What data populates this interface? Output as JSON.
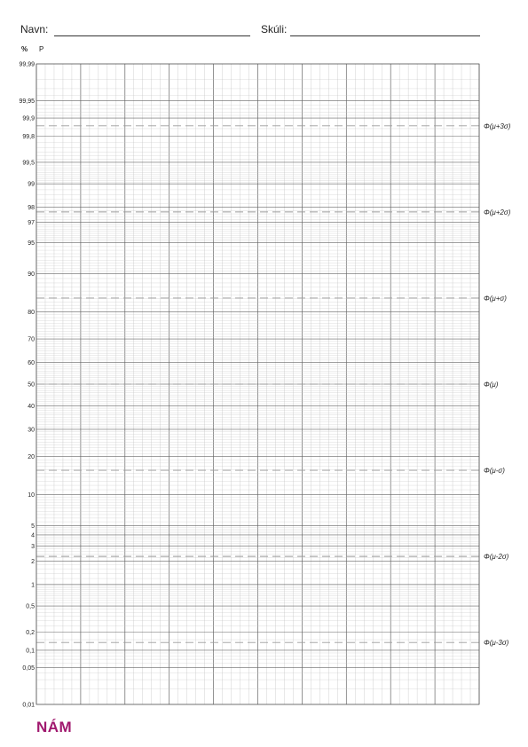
{
  "header": {
    "name_label": "Navn:",
    "school_label": "Skúli:"
  },
  "units": {
    "percent": "%",
    "probability": "P"
  },
  "y_ticks": [
    "99,99",
    "99,95",
    "99,9",
    "99,8",
    "99,5",
    "99",
    "98",
    "97",
    "95",
    "90",
    "80",
    "70",
    "60",
    "50",
    "40",
    "30",
    "20",
    "10",
    "5",
    "4",
    "3",
    "2",
    "1",
    "0,5",
    "0,2",
    "0,1",
    "0,05",
    "0,01"
  ],
  "sigma_lines": [
    {
      "label": "Φ(μ+3σ)",
      "p": 99.865
    },
    {
      "label": "Φ(μ+2σ)",
      "p": 97.725
    },
    {
      "label": "Φ(μ+σ)",
      "p": 84.13
    },
    {
      "label": "Φ(μ)",
      "p": 50
    },
    {
      "label": "Φ(μ-σ)",
      "p": 15.87
    },
    {
      "label": "Φ(μ-2σ)",
      "p": 2.275
    },
    {
      "label": "Φ(μ-3σ)",
      "p": 0.135
    }
  ],
  "logo": {
    "text": "NÁM",
    "color": "#a0186e"
  }
}
